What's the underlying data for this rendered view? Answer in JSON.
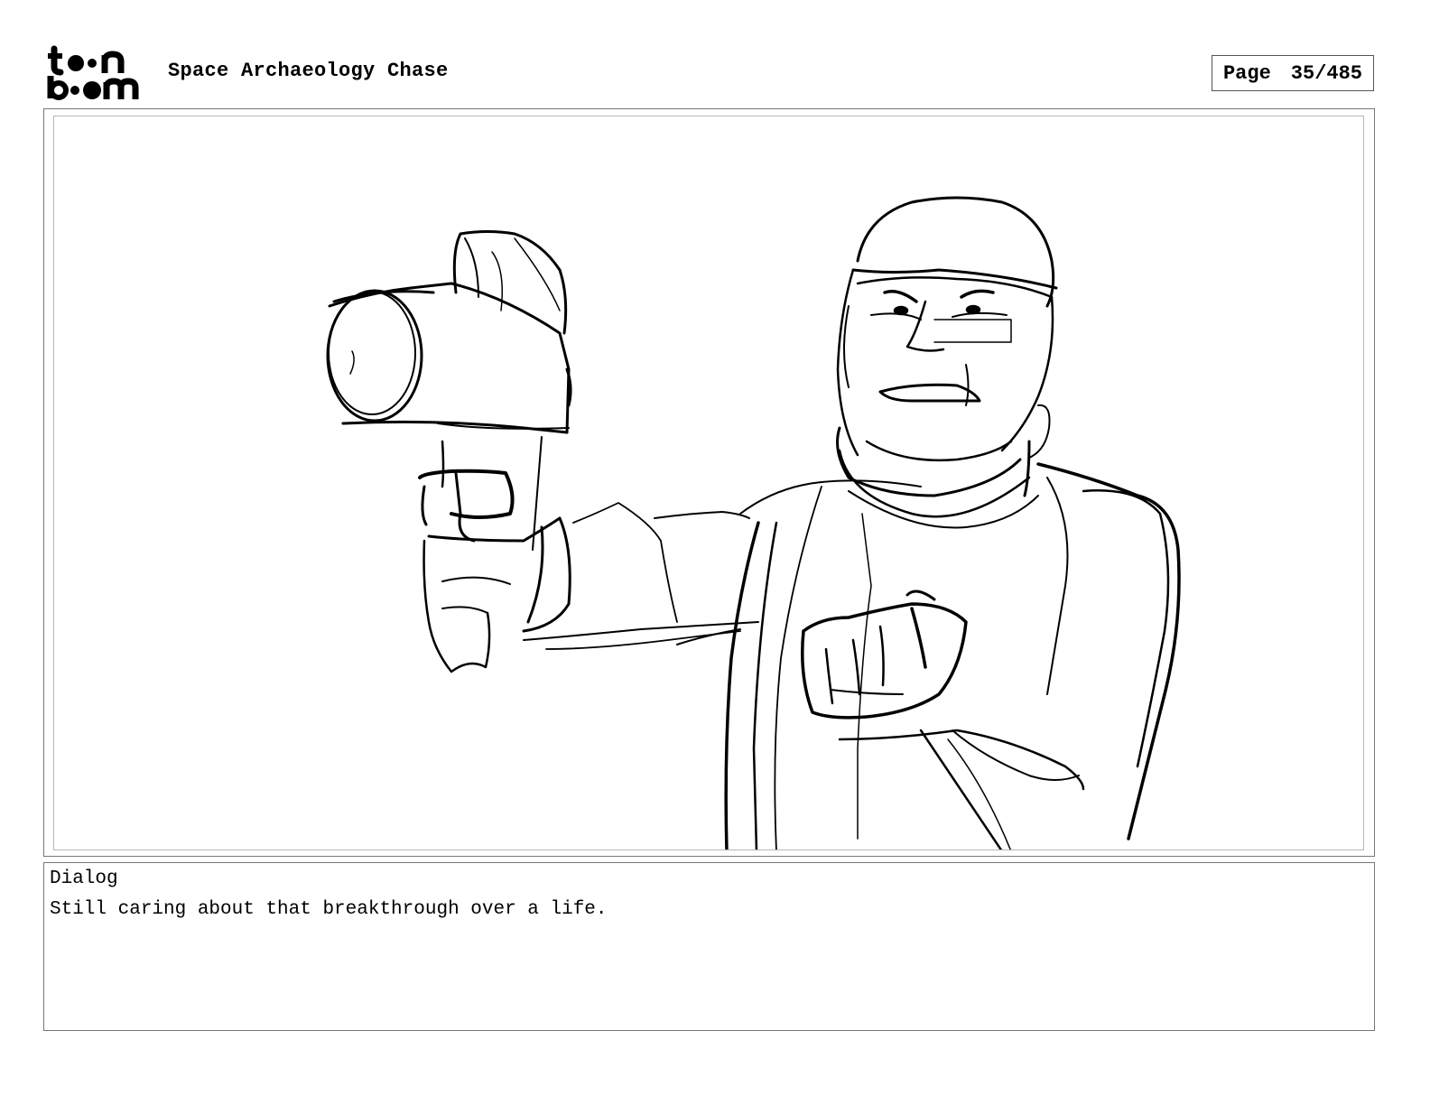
{
  "header": {
    "logo_alt": "toonboom",
    "project_title": "Space Archaeology Chase",
    "page_label": "Page",
    "page_number": "35/485"
  },
  "panel": {
    "illustration": "sketch-figure-with-blaster"
  },
  "dialog": {
    "label": "Dialog",
    "text": "Still caring about that breakthrough over a life."
  },
  "colors": {
    "ink": "#000000",
    "frame": "#777777",
    "inner_frame": "#b8b8b8"
  }
}
